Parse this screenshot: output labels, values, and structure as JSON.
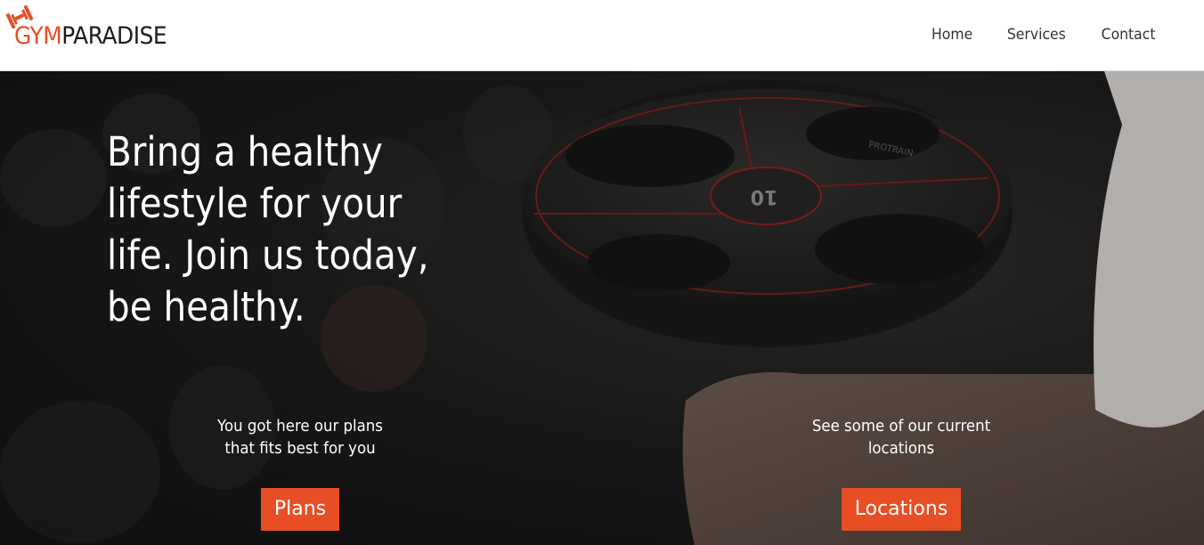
{
  "brand": {
    "name_part1": "GYM",
    "name_part2": "PARADISE",
    "accent_color": "#e84e24",
    "icon": "dumbbell-icon"
  },
  "nav": {
    "items": [
      {
        "label": "Home"
      },
      {
        "label": "Services"
      },
      {
        "label": "Contact"
      }
    ]
  },
  "hero": {
    "title": "Bring a healthy lifestyle for your life. Join us today, be healthy.",
    "weight_plate_number": "10",
    "plate_brand": "PROTRAIN"
  },
  "ctas": [
    {
      "text": "You got here our plans that fits best for you",
      "button_label": "Plans"
    },
    {
      "text": "See some of our current locations",
      "button_label": "Locations"
    }
  ]
}
